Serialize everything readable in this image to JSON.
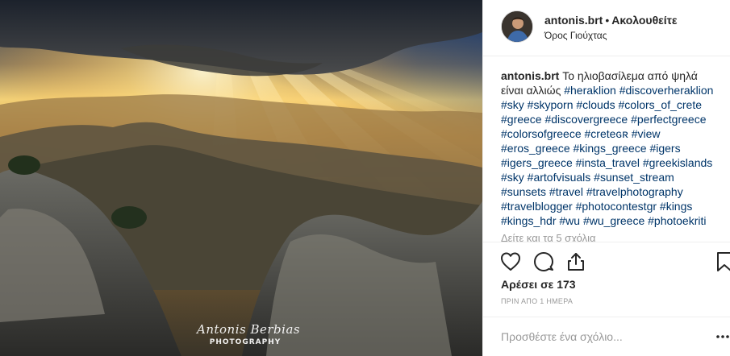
{
  "photo": {
    "watermark_signature": "Antonis Berbias",
    "watermark_subtitle": "PHOTOGRAPHY"
  },
  "header": {
    "username": "antonis.brt",
    "separator": "•",
    "follow_status": "Ακολουθείτε",
    "location": "Όρος Γιούχτας"
  },
  "caption": {
    "username": "antonis.brt",
    "text": "Το ηλιοβασίλεμα από ψηλά είναι αλλιώς",
    "hashtags": "#heraklion #discoverheraklion #sky #skyporn #clouds #colors_of_crete #greece #discovergreece #perfectgreece #colorsofgreece #creteɢʀ #view #eros_greece #kings_greece #igers #igers_greece #insta_travel #greekislands #sky #artofvisuals #sunset_stream #sunsets #travel #travelphotography #travelblogger #photocontestgr #kings #kings_hdr #wu #wu_greece #photoekriti",
    "replies_link": "Δείτε και τα 5 σχόλια"
  },
  "actions": {
    "icons": [
      "heart-icon",
      "comment-icon",
      "share-icon",
      "bookmark-icon"
    ]
  },
  "likes": "Αρέσει σε 173",
  "timestamp": "ΠΡΙΝ ΑΠΟ 1 ΗΜΕΡΑ",
  "comment_box": {
    "placeholder": "Προσθέστε ένα σχόλιο...",
    "more_icon": "more-options-icon"
  },
  "colors": {
    "hashtag": "#003569",
    "muted": "#999999",
    "text": "#262626",
    "divider": "#efefef"
  }
}
